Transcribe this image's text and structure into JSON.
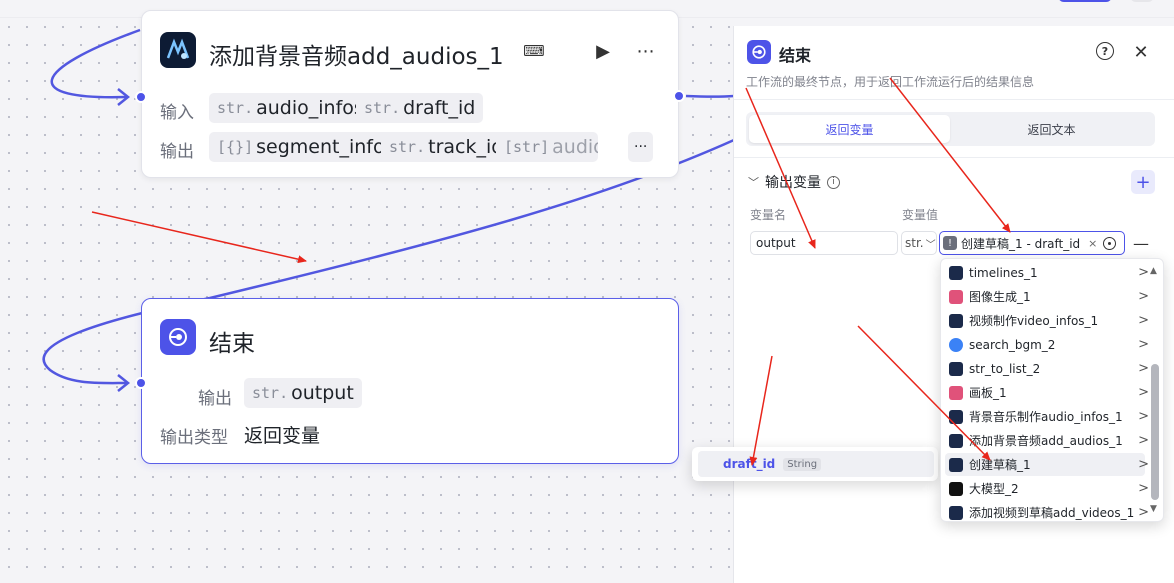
{
  "audio_node": {
    "title": "添加背景音频add_audios_1",
    "input_label": "输入",
    "output_label": "输出",
    "inputs": [
      {
        "type": "str.",
        "name": "audio_infos"
      },
      {
        "type": "str.",
        "name": "draft_id"
      }
    ],
    "outputs": [
      {
        "type": "[{}]",
        "name": "segment_infos"
      },
      {
        "type": "str.",
        "name": "track_id"
      },
      {
        "type": "[str]",
        "name": "audio_i"
      }
    ],
    "more_label": "···"
  },
  "end_node": {
    "title": "结束",
    "output_label": "输出",
    "output_type": "str.",
    "output_name": "output",
    "output_kind_label": "输出类型",
    "output_kind_value": "返回变量"
  },
  "panel": {
    "title": "结束",
    "description": "工作流的最终节点，用于返回工作流运行后的结果信息",
    "tabs": [
      {
        "label": "返回变量",
        "active": true
      },
      {
        "label": "返回文本",
        "active": false
      }
    ],
    "section_title": "输出变量",
    "col_name": "变量名",
    "col_value": "变量值",
    "var_name": "output",
    "var_type": "str.",
    "var_ref": "创建草稿_1 - draft_id"
  },
  "dropdown": {
    "items": [
      {
        "label": "timelines_1",
        "icon_color": "#1b2a4a"
      },
      {
        "label": "图像生成_1",
        "icon_color": "#e0527a"
      },
      {
        "label": "视频制作video_infos_1",
        "icon_color": "#1b2a4a"
      },
      {
        "label": "search_bgm_2",
        "icon_color": "#3b82f6"
      },
      {
        "label": "str_to_list_2",
        "icon_color": "#1b2a4a"
      },
      {
        "label": "画板_1",
        "icon_color": "#e0527a"
      },
      {
        "label": "背景音乐制作audio_infos_1",
        "icon_color": "#1b2a4a"
      },
      {
        "label": "添加背景音频add_audios_1",
        "icon_color": "#1b2a4a"
      },
      {
        "label": "创建草稿_1",
        "icon_color": "#1b2a4a"
      },
      {
        "label": "大模型_2",
        "icon_color": "#111111"
      },
      {
        "label": "添加视频到草稿add_videos_1",
        "icon_color": "#1b2a4a"
      }
    ],
    "highlighted_index": 8
  },
  "subpop": {
    "name": "draft_id",
    "type": "String"
  },
  "colors": {
    "accent": "#4d53e8",
    "annotation": "#e8261c"
  }
}
